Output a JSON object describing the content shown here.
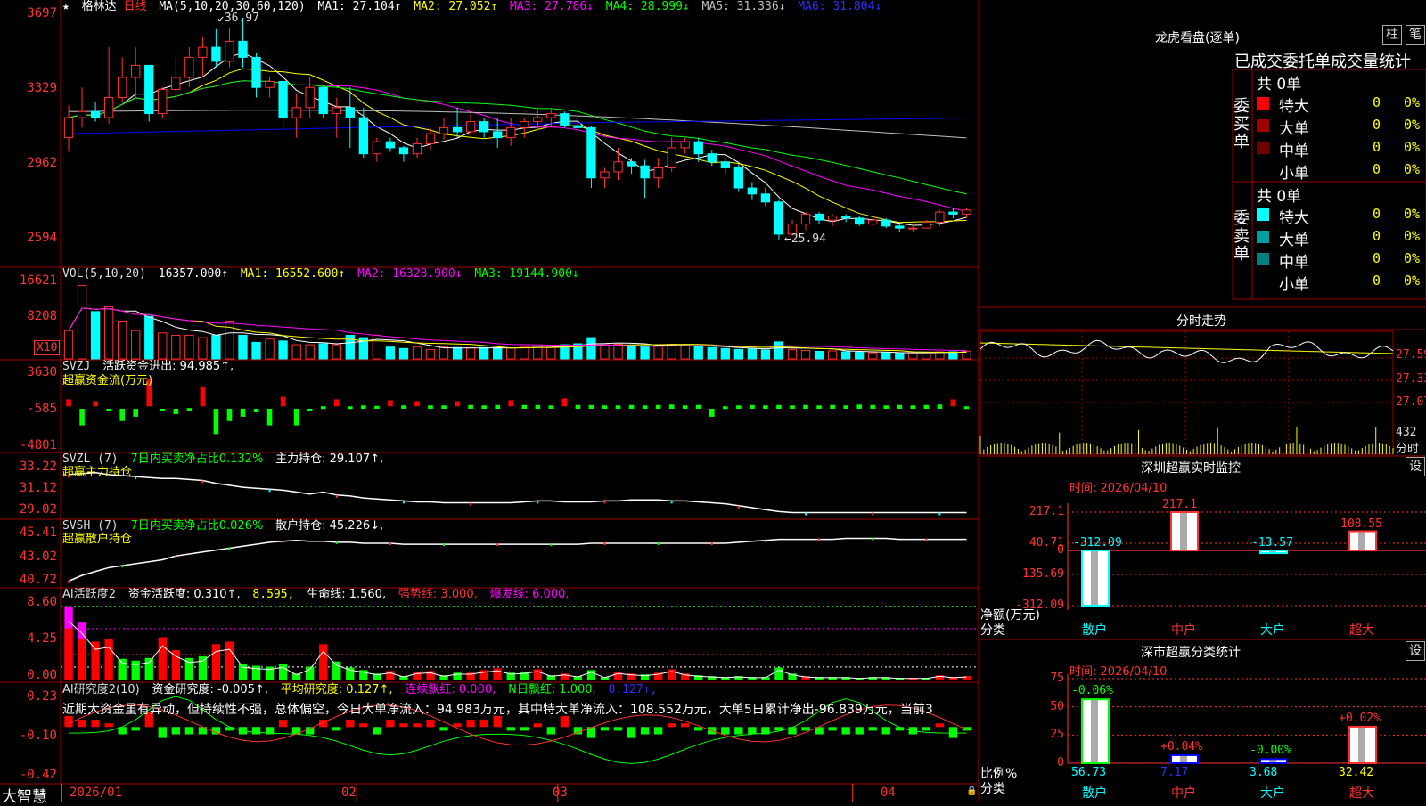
{
  "stock": {
    "name": "格林达",
    "period": "日线",
    "star": "★"
  },
  "main_header": {
    "ma_def": "MA(5,10,20,30,60,120)",
    "ma1": "MA1: 27.104↑",
    "ma2": "MA2: 27.052↑",
    "ma3": "MA3: 27.786↓",
    "ma4": "MA4: 28.999↓",
    "ma5": "MA5: 31.336↓",
    "ma6": "MA6: 31.804↓"
  },
  "price_axis": [
    "3697",
    "3329",
    "2962",
    "2594"
  ],
  "annotations": {
    "high": "36.97",
    "low": "25.94"
  },
  "vol_header": {
    "def": "VOL(5,10,20)",
    "val": "16357.000↑",
    "ma1": "MA1: 16552.600↑",
    "ma2": "MA2: 16328.900↓",
    "ma3": "MA3: 19144.900↓"
  },
  "vol_axis": [
    "16621",
    "8208"
  ],
  "vol_unit": "X10",
  "svzj": {
    "title": "SVZJ",
    "label": "活跃资金进出: 94.985↑,",
    "sub": "超赢资金流(万元)",
    "axis": [
      "3630",
      "-585",
      "-4801"
    ]
  },
  "svzl": {
    "title": "SVZL (7)",
    "label": "7日内买卖净占比0.132%",
    "label2": "主力持仓: 29.107↑,",
    "sub": "超赢主力持仓",
    "axis": [
      "33.22",
      "31.12",
      "29.02"
    ]
  },
  "svsh": {
    "title": "SVSH (7)",
    "label": "7日内买卖净占比0.026%",
    "label2": "散户持仓: 45.226↓,",
    "sub": "超赢散户持仓",
    "axis": [
      "45.41",
      "43.02",
      "40.72"
    ]
  },
  "ai_active": {
    "title": "AI活跃度2",
    "l1": "资金活跃度: 0.310↑,",
    "l2": "8.595,",
    "l3": "生命线: 1.560,",
    "l4": "强势线: 3.000,",
    "l5": "爆发线: 6.000,",
    "axis": [
      "8.60",
      "4.25",
      "0.00"
    ]
  },
  "ai_research": {
    "title": "AI研究度2(10)",
    "l1": "资金研究度: -0.005↑,",
    "l2": "平均研究度: 0.127↑,",
    "l3": "连续飘红: 0.000,",
    "l4": "N日飘红: 1.000,",
    "l5": "0.127↑,",
    "comment": "近期大资金虽有异动，但持续性不强，总体偏空，今日大单净流入：94.983万元，其中特大单净流入：108.552万元，大单5日累计净出-96.839万元，当前3",
    "axis": [
      "0.23",
      "-0.10",
      "-0.42"
    ]
  },
  "date_axis": [
    "2026/01",
    "02",
    "03",
    "04"
  ],
  "bottom_left": "大智慧",
  "dragon_tiger": {
    "title": "龙虎看盘(逐单)",
    "btn1": "柱",
    "btn2": "笔",
    "stat_title": "已成交委托单成交量统计",
    "buy_label": "委买单",
    "sell_label": "委卖单",
    "buy_total": "共 0单",
    "sell_total": "共 0单",
    "buy_rows": [
      {
        "name": "特大",
        "count": "0",
        "pct": "0%",
        "color": "#ff0000"
      },
      {
        "name": "大单",
        "count": "0",
        "pct": "0%",
        "color": "#a00000"
      },
      {
        "name": "中单",
        "count": "0",
        "pct": "0%",
        "color": "#700000"
      },
      {
        "name": "小单",
        "count": "0",
        "pct": "0%",
        "color": "#000000"
      }
    ],
    "sell_rows": [
      {
        "name": "特大",
        "count": "0",
        "pct": "0%",
        "color": "#00ffff"
      },
      {
        "name": "大单",
        "count": "0",
        "pct": "0%",
        "color": "#00a0a0"
      },
      {
        "name": "中单",
        "count": "0",
        "pct": "0%",
        "color": "#008080"
      },
      {
        "name": "小单",
        "count": "0",
        "pct": "0%",
        "color": "#000000"
      }
    ]
  },
  "intraday": {
    "title": "分时走势",
    "axis": [
      "27.59",
      "27.33",
      "27.07"
    ],
    "vol_axis": "432",
    "vol_unit": "分时"
  },
  "sz_monitor": {
    "title": "深圳超赢实时监控",
    "btn": "设",
    "time": "时间: 2026/04/10",
    "axis": [
      "217.1",
      "40.71",
      "0",
      "-135.69",
      "-312.09"
    ],
    "ylabel": "净额(万元)",
    "xlabel": "分类",
    "categories": [
      "散户",
      "中户",
      "大户",
      "超大"
    ],
    "values": [
      -312.09,
      217.1,
      -13.57,
      108.55
    ],
    "labels": [
      "-312.09",
      "217.1",
      "-13.57",
      "108.55"
    ]
  },
  "sz_class": {
    "title": "深市超赢分类统计",
    "btn": "设",
    "time": "时间: 2026/04/10",
    "axis": [
      "75",
      "50",
      "25",
      "0"
    ],
    "ylabel": "比例%",
    "xlabel": "分类",
    "categories": [
      "散户",
      "中户",
      "大户",
      "超大"
    ],
    "values": [
      56.73,
      7.17,
      3.68,
      32.42
    ],
    "changes": [
      "-0.06%",
      "+0.04%",
      "-0.00%",
      "+0.02%"
    ],
    "labels": [
      "56.73",
      "7.17",
      "3.68",
      "32.42"
    ]
  },
  "colors": {
    "up": "#ff3232",
    "down": "#00ffff",
    "grid": "#a00000",
    "ma1": "#ffffff",
    "ma2": "#ffff00",
    "ma3": "#ff00ff",
    "ma4": "#00ff00",
    "ma5": "#c0c0c0",
    "ma6": "#0000ff"
  },
  "chart_data": {
    "type": "candlestick",
    "price_range": [
      25.0,
      37.5
    ],
    "candles": [
      [
        31.0,
        32.6,
        30.3,
        32.0
      ],
      [
        32.0,
        33.5,
        31.5,
        32.3
      ],
      [
        32.3,
        32.8,
        31.8,
        32.0
      ],
      [
        32.0,
        35.5,
        31.7,
        33.0
      ],
      [
        33.0,
        35.0,
        32.8,
        34.0
      ],
      [
        34.0,
        35.5,
        33.0,
        34.6
      ],
      [
        34.6,
        34.6,
        31.8,
        32.2
      ],
      [
        32.2,
        33.5,
        32.0,
        33.4
      ],
      [
        33.4,
        35.0,
        33.0,
        34.0
      ],
      [
        34.0,
        35.5,
        33.5,
        35.0
      ],
      [
        35.0,
        36.0,
        34.0,
        35.5
      ],
      [
        35.5,
        36.4,
        34.5,
        34.8
      ],
      [
        34.8,
        36.5,
        34.5,
        35.8
      ],
      [
        35.8,
        36.97,
        34.5,
        35.0
      ],
      [
        35.0,
        35.2,
        33.0,
        33.5
      ],
      [
        33.5,
        34.0,
        33.0,
        33.8
      ],
      [
        33.8,
        34.0,
        31.5,
        32.0
      ],
      [
        32.0,
        33.2,
        31.0,
        32.5
      ],
      [
        32.5,
        34.0,
        32.0,
        33.5
      ],
      [
        33.5,
        33.6,
        32.0,
        32.2
      ],
      [
        32.2,
        33.0,
        31.0,
        32.5
      ],
      [
        32.5,
        33.5,
        30.5,
        32.0
      ],
      [
        32.0,
        32.5,
        30.0,
        30.2
      ],
      [
        30.2,
        31.0,
        29.8,
        30.8
      ],
      [
        30.8,
        31.0,
        30.3,
        30.5
      ],
      [
        30.5,
        30.6,
        29.8,
        30.2
      ],
      [
        30.2,
        31.0,
        30.0,
        30.7
      ],
      [
        30.7,
        31.5,
        30.4,
        31.2
      ],
      [
        31.2,
        32.0,
        30.9,
        31.5
      ],
      [
        31.5,
        32.5,
        31.0,
        31.3
      ],
      [
        31.3,
        32.2,
        31.1,
        31.8
      ],
      [
        31.8,
        32.0,
        31.0,
        31.3
      ],
      [
        31.3,
        32.0,
        30.5,
        31.0
      ],
      [
        31.0,
        32.0,
        30.6,
        31.5
      ],
      [
        31.5,
        32.0,
        31.0,
        31.8
      ],
      [
        31.8,
        32.4,
        31.4,
        32.0
      ],
      [
        32.0,
        32.5,
        31.6,
        32.2
      ],
      [
        32.2,
        32.3,
        31.5,
        31.6
      ],
      [
        31.6,
        32.0,
        31.4,
        31.5
      ],
      [
        31.5,
        31.6,
        28.5,
        29.0
      ],
      [
        29.0,
        29.5,
        28.5,
        29.3
      ],
      [
        29.3,
        30.5,
        28.9,
        29.8
      ],
      [
        29.8,
        30.0,
        29.2,
        29.6
      ],
      [
        29.6,
        29.9,
        28.0,
        29.0
      ],
      [
        29.0,
        30.0,
        28.5,
        29.5
      ],
      [
        29.5,
        31.0,
        29.3,
        30.5
      ],
      [
        30.5,
        31.0,
        30.2,
        30.8
      ],
      [
        30.8,
        31.0,
        29.8,
        30.2
      ],
      [
        30.2,
        30.4,
        29.6,
        29.8
      ],
      [
        29.8,
        30.0,
        29.2,
        29.5
      ],
      [
        29.5,
        29.7,
        28.3,
        28.5
      ],
      [
        28.5,
        28.8,
        27.9,
        28.2
      ],
      [
        28.2,
        28.5,
        27.6,
        27.8
      ],
      [
        27.8,
        27.9,
        25.94,
        26.2
      ],
      [
        26.2,
        26.9,
        26.1,
        26.7
      ],
      [
        26.7,
        27.3,
        26.4,
        27.2
      ],
      [
        27.2,
        27.3,
        26.7,
        26.9
      ],
      [
        26.9,
        27.2,
        26.6,
        27.1
      ],
      [
        27.1,
        27.2,
        26.8,
        27.0
      ],
      [
        27.0,
        27.1,
        26.6,
        26.7
      ],
      [
        26.7,
        27.0,
        26.6,
        26.9
      ],
      [
        26.9,
        27.0,
        26.5,
        26.6
      ],
      [
        26.6,
        26.7,
        26.3,
        26.5
      ],
      [
        26.5,
        26.7,
        26.3,
        26.5
      ],
      [
        26.5,
        26.9,
        26.5,
        26.8
      ],
      [
        26.8,
        27.4,
        26.6,
        27.3
      ],
      [
        27.3,
        27.5,
        27.0,
        27.2
      ],
      [
        27.2,
        27.5,
        27.0,
        27.4
      ]
    ],
    "vol_range": [
      0,
      17500
    ],
    "volume": [
      6000,
      15500,
      10000,
      11000,
      8000,
      6000,
      9000,
      5500,
      5000,
      5000,
      4500,
      5000,
      8000,
      5000,
      3500,
      4200,
      3800,
      3000,
      3000,
      3200,
      3000,
      5000,
      4500,
      5000,
      2500,
      2200,
      2500,
      2000,
      2500,
      2400,
      2300,
      2400,
      2200,
      2300,
      2600,
      2700,
      2500,
      3000,
      3200,
      4500,
      3000,
      3100,
      2800,
      2600,
      2700,
      3100,
      2800,
      2600,
      2400,
      2200,
      2000,
      2100,
      1900,
      3600,
      2000,
      1800,
      1600,
      1700,
      1500,
      1400,
      1300,
      1300,
      1200,
      1300,
      1400,
      1500,
      1500,
      1636
    ],
    "svzj_range": [
      -4801,
      3630
    ],
    "svzj": [
      500,
      -2500,
      300,
      -800,
      -2000,
      -1500,
      2800,
      -800,
      -1200,
      -500,
      2000,
      -3500,
      -2000,
      -1500,
      -1000,
      -2500,
      800,
      -2500,
      -700,
      -300,
      500,
      -300,
      -200,
      -250,
      400,
      -200,
      300,
      -200,
      -200,
      300,
      -150,
      -200,
      -150,
      400,
      -150,
      -150,
      -200,
      600,
      -150,
      -150,
      -200,
      -200,
      -150,
      -200,
      -150,
      -100,
      -200,
      -150,
      -1500,
      -300,
      -200,
      -150,
      -200,
      -150,
      -200,
      -150,
      -200,
      -150,
      -200,
      -100,
      -150,
      -200,
      -150,
      -200,
      -150,
      -100,
      500,
      -300
    ],
    "svzl_range": [
      28.5,
      34.0
    ],
    "svzl": [
      33.0,
      33.1,
      33.2,
      33.0,
      32.9,
      32.8,
      32.7,
      32.6,
      32.6,
      32.5,
      32.4,
      32.1,
      31.9,
      31.7,
      31.6,
      31.5,
      31.4,
      31.2,
      31.0,
      31.2,
      30.9,
      30.8,
      30.6,
      30.5,
      30.4,
      30.3,
      30.2,
      30.2,
      30.1,
      30.1,
      30.1,
      30.1,
      30.1,
      30.1,
      30.2,
      30.3,
      30.3,
      30.2,
      30.2,
      30.2,
      30.3,
      30.3,
      30.4,
      30.4,
      30.4,
      30.3,
      30.3,
      30.2,
      30.1,
      30.0,
      29.8,
      29.6,
      29.4,
      29.2,
      29.1,
      29.1,
      29.1,
      29.1,
      29.1,
      29.1,
      29.1,
      29.1,
      29.1,
      29.1,
      29.1,
      29.1,
      29.1,
      29.1
    ],
    "svsh_range": [
      40.5,
      46.0
    ],
    "svsh": [
      41.0,
      41.6,
      42.0,
      42.4,
      42.6,
      42.8,
      43.0,
      43.2,
      43.6,
      43.8,
      44.0,
      44.2,
      44.4,
      44.6,
      44.8,
      45.0,
      45.1,
      45.2,
      45.1,
      45.1,
      45.0,
      45.0,
      44.9,
      44.9,
      44.9,
      44.8,
      44.8,
      44.8,
      44.8,
      44.8,
      44.8,
      44.8,
      44.8,
      44.8,
      44.8,
      44.8,
      44.8,
      44.8,
      44.8,
      44.9,
      44.9,
      44.9,
      44.9,
      44.9,
      44.9,
      44.9,
      44.9,
      44.9,
      44.9,
      44.9,
      45.0,
      45.1,
      45.2,
      45.3,
      45.3,
      45.3,
      45.3,
      45.3,
      45.4,
      45.4,
      45.4,
      45.4,
      45.3,
      45.3,
      45.3,
      45.3,
      45.3,
      45.3
    ],
    "active_range": [
      0,
      9.5
    ],
    "active": [
      8.6,
      6.8,
      4.5,
      4.8,
      2.5,
      2.3,
      2.6,
      5.0,
      3.5,
      2.6,
      2.8,
      4.2,
      4.5,
      1.9,
      1.7,
      1.6,
      1.9,
      0.8,
      1.6,
      4.2,
      2.2,
      1.5,
      1.2,
      0.8,
      1.1,
      0.5,
      1.0,
      1.1,
      0.6,
      0.9,
      0.9,
      1.2,
      1.4,
      0.9,
      1.0,
      1.3,
      0.6,
      0.8,
      0.5,
      1.2,
      0.4,
      1.0,
      0.8,
      0.7,
      0.9,
      1.3,
      0.8,
      0.6,
      0.5,
      0.4,
      0.5,
      0.4,
      0.4,
      1.5,
      0.8,
      0.5,
      0.4,
      0.4,
      0.4,
      0.3,
      0.4,
      0.4,
      0.3,
      0.3,
      0.3,
      0.6,
      0.4,
      0.5
    ],
    "active_up": [
      1,
      1,
      1,
      1,
      0,
      0,
      0,
      1,
      1,
      0,
      0,
      1,
      1,
      0,
      0,
      0,
      0,
      0,
      0,
      1,
      0,
      0,
      0,
      0,
      1,
      0,
      1,
      1,
      0,
      0,
      1,
      1,
      1,
      0,
      0,
      1,
      0,
      1,
      0,
      0,
      0,
      1,
      1,
      0,
      1,
      1,
      1,
      0,
      0,
      0,
      0,
      0,
      0,
      0,
      0,
      1,
      0,
      0,
      0,
      0,
      0,
      0,
      0,
      1,
      0,
      1,
      1,
      1
    ],
    "research_range": [
      -0.45,
      0.25
    ],
    "research": [
      0.03,
      0.02,
      0.02,
      0.01,
      -0.02,
      -0.01,
      0.04,
      -0.03,
      -0.02,
      -0.02,
      -0.02,
      -0.02,
      -0.01,
      -0.02,
      -0.02,
      -0.02,
      0.02,
      -0.02,
      -0.02,
      0.02,
      -0.01,
      0.02,
      0.01,
      -0.02,
      0.02,
      0.01,
      0.01,
      0.02,
      -0.01,
      0.01,
      0.02,
      0.02,
      0.03,
      -0.01,
      -0.01,
      0.01,
      -0.02,
      0.03,
      -0.02,
      -0.03,
      -0.01,
      -0.01,
      -0.03,
      -0.02,
      -0.02,
      0.01,
      0.01,
      -0.01,
      -0.02,
      -0.02,
      -0.02,
      -0.02,
      -0.02,
      -0.01,
      -0.02,
      -0.01,
      -0.02,
      -0.01,
      -0.02,
      -0.02,
      -0.01,
      -0.02,
      -0.01,
      -0.02,
      -0.01,
      0.01,
      -0.03,
      -0.01
    ]
  }
}
